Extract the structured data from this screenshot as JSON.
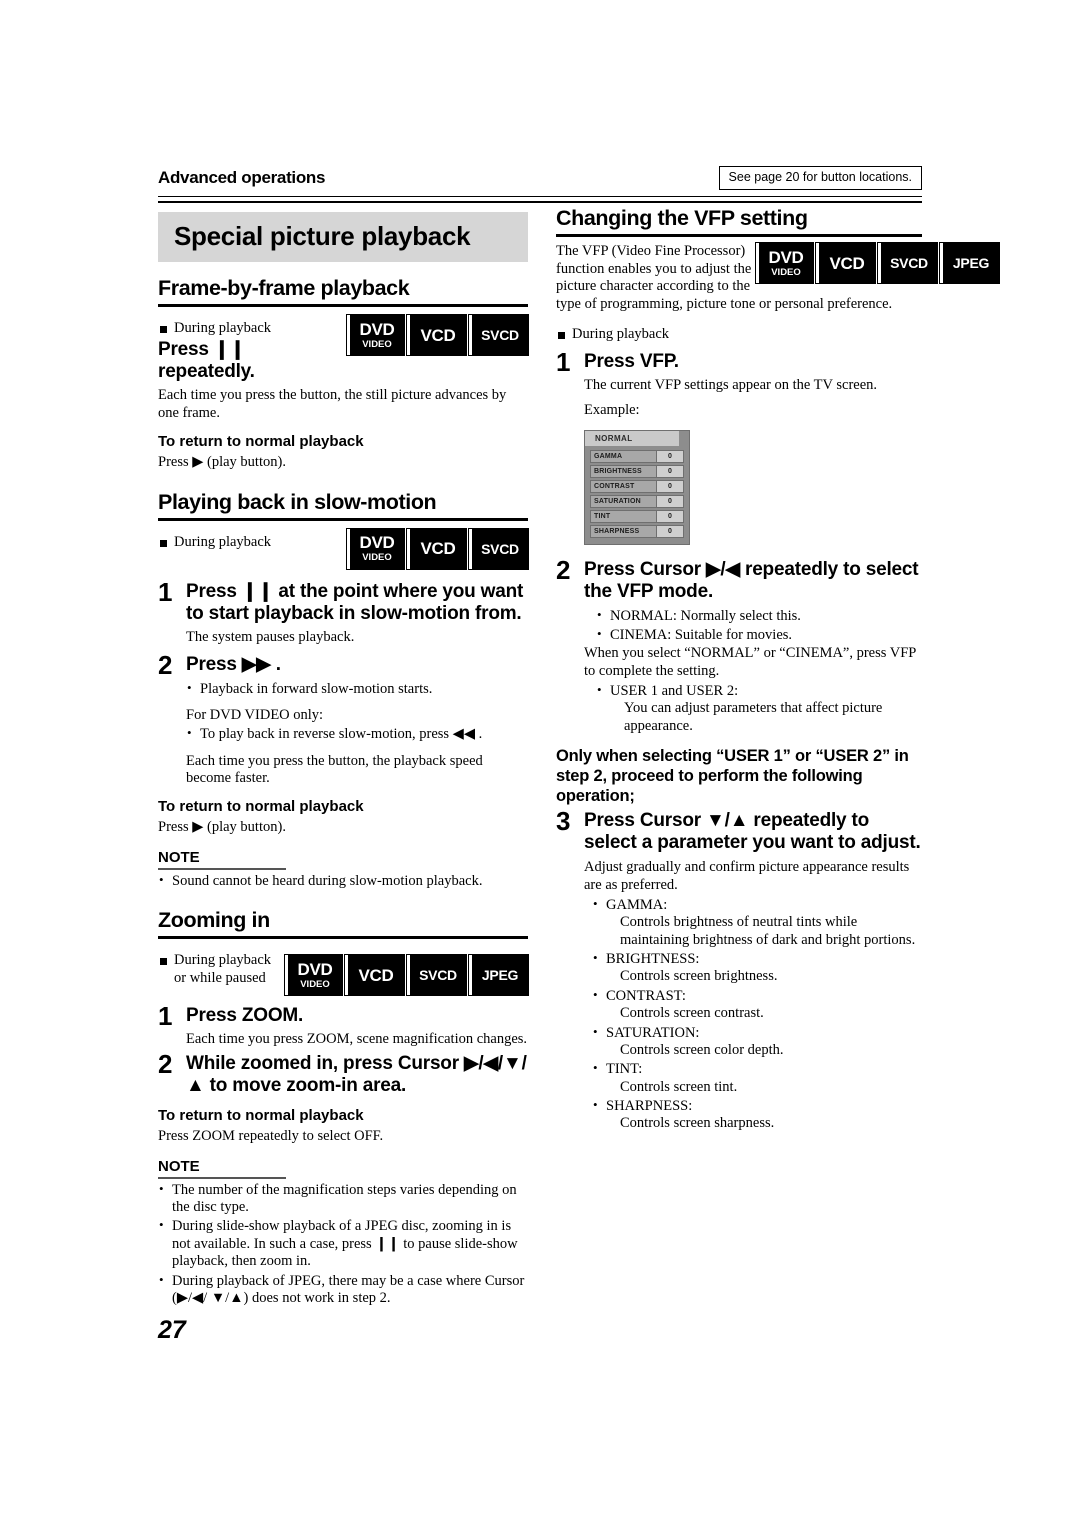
{
  "header": {
    "section_label": "Advanced operations",
    "note_box": "See page 20 for button locations."
  },
  "page_number": "27",
  "left_column": {
    "banner_title": "Special picture playback",
    "sections": [
      {
        "heading": "Frame-by-frame playback",
        "condition": "During playback",
        "badges": [
          "DVD VIDEO",
          "VCD",
          "SVCD"
        ],
        "instruction": "Press ❙❙ repeatedly.",
        "description": "Each time you press the button, the still picture advances by one frame.",
        "return_heading": "To return to normal playback",
        "return_text": "Press ▶ (play button)."
      },
      {
        "heading": "Playing back in slow-motion",
        "condition": "During playback",
        "badges": [
          "DVD VIDEO",
          "VCD",
          "SVCD"
        ],
        "step1_num": "1",
        "step1_instruction": "Press ❙❙ at the point where you want to start playback in slow-motion from.",
        "step1_desc": "The system pauses playback.",
        "step2_num": "2",
        "step2_instruction": "Press ▶▶ .",
        "step2_bullet": "Playback in forward slow-motion starts.",
        "dvd_only_label": "For DVD VIDEO only:",
        "dvd_only_bullet": "To play back in reverse slow-motion, press ◀◀ .",
        "speed_text": "Each time you press the button, the playback speed become faster.",
        "return_heading": "To return to normal playback",
        "return_text": "Press ▶ (play button).",
        "note_heading": "NOTE",
        "notes": [
          "Sound cannot be heard during slow-motion playback."
        ]
      },
      {
        "heading": "Zooming in",
        "condition": "During playback or while paused",
        "badges": [
          "DVD VIDEO",
          "VCD",
          "SVCD",
          "JPEG"
        ],
        "step1_num": "1",
        "step1_instruction": "Press ZOOM.",
        "step1_desc": "Each time you press ZOOM, scene magnification changes.",
        "step2_num": "2",
        "step2_instruction": "While zoomed in, press Cursor ▶/◀/▼/ ▲ to move zoom-in area.",
        "return_heading": "To return to normal playback",
        "return_text": "Press ZOOM repeatedly to select OFF.",
        "note_heading": "NOTE",
        "notes": [
          "The number of the magnification steps varies depending on the disc type.",
          "During slide-show playback of a JPEG disc, zooming in is not available. In such a case, press ❙❙ to pause slide-show playback, then zoom in.",
          "During playback of JPEG, there may be a case where Cursor (▶/◀/ ▼/▲) does not work in step 2."
        ]
      }
    ]
  },
  "right_column": {
    "heading": "Changing the VFP setting",
    "intro_line1": "The VFP (Video Fine Processor)",
    "intro_line2": "function enables you to adjust the",
    "intro_line3": "picture character according to the",
    "intro_line4": "type of programming, picture tone or personal preference.",
    "badges": [
      "DVD VIDEO",
      "VCD",
      "SVCD",
      "JPEG"
    ],
    "condition": "During playback",
    "step1_num": "1",
    "step1_instruction": "Press VFP.",
    "step1_desc": "The current VFP settings appear on the TV screen.",
    "example_label": "Example:",
    "osd": {
      "title": "NORMAL",
      "rows": [
        {
          "label": "GAMMA",
          "value": "0"
        },
        {
          "label": "BRIGHTNESS",
          "value": "0"
        },
        {
          "label": "CONTRAST",
          "value": "0"
        },
        {
          "label": "SATURATION",
          "value": "0"
        },
        {
          "label": "TINT",
          "value": "0"
        },
        {
          "label": "SHARPNESS",
          "value": "0"
        }
      ]
    },
    "step2_num": "2",
    "step2_instruction": "Press Cursor ▶/◀ repeatedly to select the VFP mode.",
    "step2_bullets": [
      "NORMAL: Normally select this.",
      "CINEMA:  Suitable for movies."
    ],
    "step2_body": "When you select “NORMAL” or “CINEMA”, press VFP to complete the setting.",
    "step2_user_bullet": "USER 1 and USER 2:",
    "step2_user_desc": "You can adjust parameters that affect picture appearance.",
    "only_when": "Only when selecting “USER 1” or “USER 2” in step 2, proceed to perform the following operation;",
    "step3_num": "3",
    "step3_instruction": "Press Cursor ▼/▲ repeatedly to select a parameter you want to adjust.",
    "step3_desc": "Adjust gradually and confirm picture appearance results are as preferred.",
    "parameters": [
      {
        "name": "GAMMA:",
        "desc": "Controls brightness of neutral tints while maintaining brightness of dark and bright portions."
      },
      {
        "name": "BRIGHTNESS:",
        "desc": "Controls screen brightness."
      },
      {
        "name": "CONTRAST:",
        "desc": "Controls screen contrast."
      },
      {
        "name": "SATURATION:",
        "desc": "Controls screen color depth."
      },
      {
        "name": "TINT:",
        "desc": "Controls screen tint."
      },
      {
        "name": "SHARPNESS:",
        "desc": "Controls screen sharpness."
      }
    ]
  },
  "colors": {
    "banner_bg": "#d6d6d6",
    "badge_bg": "#000000",
    "osd_frame": "#8d8d8d",
    "osd_title_bg": "#c9c9c9",
    "osd_row_bg": "#a8a8a8",
    "osd_value_bg": "#cfcfcf"
  }
}
